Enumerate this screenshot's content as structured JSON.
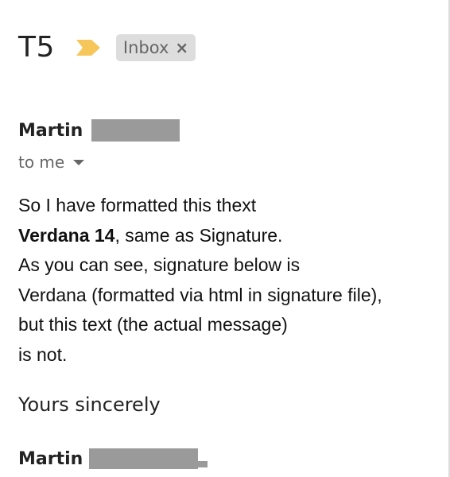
{
  "email": {
    "subject": "T5",
    "importance_icon": "importance-marker-icon",
    "importance_color": "#f6c65b",
    "label": {
      "text": "Inbox",
      "close": "×"
    },
    "sender": {
      "name": "Martin"
    },
    "recipient": {
      "text": "to me",
      "toggle_icon": "chevron-down-icon"
    },
    "body": {
      "line1": "So I have formatted this thext",
      "line2_bold": "Verdana 14",
      "line2_rest": ", same as Signature.",
      "line3": "As you can see, signature below is",
      "line4": "Verdana (formatted via html in signature file),",
      "line5": "but this text (the actual message)",
      "line6": "is not."
    },
    "closing": "Yours sincerely",
    "signature": {
      "name": "Martin"
    }
  }
}
